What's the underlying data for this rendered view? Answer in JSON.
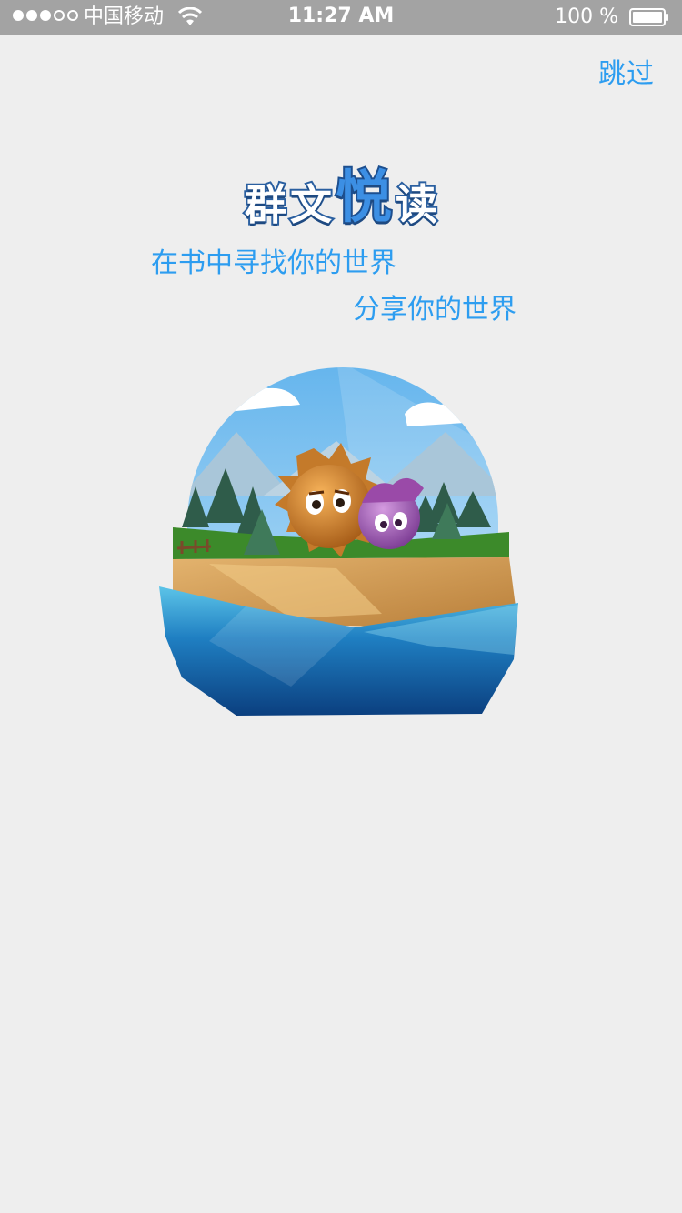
{
  "status_bar": {
    "carrier": "中国移动",
    "time": "11:27 AM",
    "battery": "100 %",
    "signal_bars_filled": 3,
    "signal_bars_total": 5
  },
  "skip_label": "跳过",
  "logo": {
    "chars": [
      "群",
      "文",
      "悦",
      "读"
    ]
  },
  "slogans": [
    "在书中寻找你的世界",
    "分享你的世界"
  ],
  "colors": {
    "accent": "#2d9df0",
    "background": "#eeeeee",
    "status_bar": "#a3a3a3"
  },
  "illustration": {
    "icon": "floating-island-illustration"
  }
}
